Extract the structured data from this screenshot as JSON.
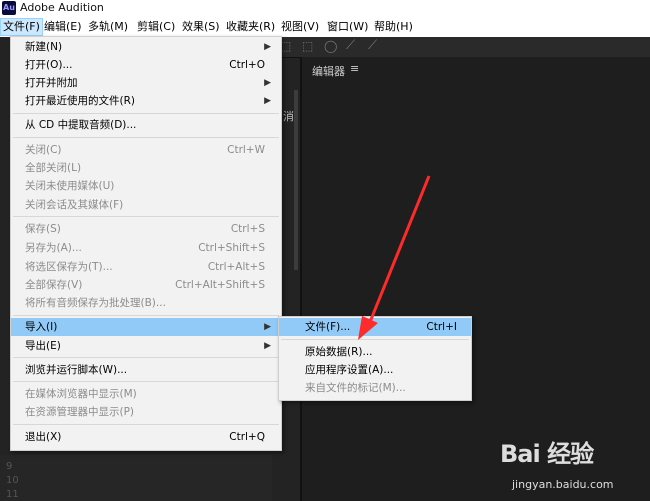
{
  "window": {
    "title": "Adobe Audition",
    "icon": "Au"
  },
  "menubar": [
    {
      "label": "文件(F)",
      "active": true
    },
    {
      "label": "编辑(E)"
    },
    {
      "label": "多轨(M)"
    },
    {
      "label": "剪辑(C)"
    },
    {
      "label": "效果(S)"
    },
    {
      "label": "收藏夹(R)"
    },
    {
      "label": "视图(V)"
    },
    {
      "label": "窗口(W)"
    },
    {
      "label": "帮助(H)"
    }
  ],
  "editor": {
    "tab_label": "编辑器",
    "tab_menu": "≡"
  },
  "file_menu": {
    "items": [
      {
        "label": "新建(N)",
        "shortcut": "",
        "submenu": true,
        "disabled": false
      },
      {
        "label": "打开(O)...",
        "shortcut": "Ctrl+O",
        "submenu": false,
        "disabled": false
      },
      {
        "label": "打开并附加",
        "shortcut": "",
        "submenu": true,
        "disabled": false
      },
      {
        "label": "打开最近使用的文件(R)",
        "shortcut": "",
        "submenu": true,
        "disabled": false
      },
      {
        "label": "从 CD 中提取音频(D)...",
        "shortcut": "",
        "submenu": false,
        "disabled": false
      },
      {
        "label": "关闭(C)",
        "shortcut": "Ctrl+W",
        "submenu": false,
        "disabled": true
      },
      {
        "label": "全部关闭(L)",
        "shortcut": "",
        "submenu": false,
        "disabled": true
      },
      {
        "label": "关闭未使用媒体(U)",
        "shortcut": "",
        "submenu": false,
        "disabled": true
      },
      {
        "label": "关闭会话及其媒体(F)",
        "shortcut": "",
        "submenu": false,
        "disabled": true
      },
      {
        "label": "保存(S)",
        "shortcut": "Ctrl+S",
        "submenu": false,
        "disabled": true
      },
      {
        "label": "另存为(A)...",
        "shortcut": "Ctrl+Shift+S",
        "submenu": false,
        "disabled": true
      },
      {
        "label": "将选区保存为(T)...",
        "shortcut": "Ctrl+Alt+S",
        "submenu": false,
        "disabled": true
      },
      {
        "label": "全部保存(V)",
        "shortcut": "Ctrl+Alt+Shift+S",
        "submenu": false,
        "disabled": true
      },
      {
        "label": "将所有音频保存为批处理(B)...",
        "shortcut": "",
        "submenu": false,
        "disabled": true
      },
      {
        "label": "导入(I)",
        "shortcut": "",
        "submenu": true,
        "disabled": false,
        "highlighted": true
      },
      {
        "label": "导出(E)",
        "shortcut": "",
        "submenu": true,
        "disabled": false
      },
      {
        "label": "浏览并运行脚本(W)...",
        "shortcut": "",
        "submenu": false,
        "disabled": false
      },
      {
        "label": "在媒体浏览器中显示(M)",
        "shortcut": "",
        "submenu": false,
        "disabled": true
      },
      {
        "label": "在资源管理器中显示(P)",
        "shortcut": "",
        "submenu": false,
        "disabled": true
      },
      {
        "label": "退出(X)",
        "shortcut": "Ctrl+Q",
        "submenu": false,
        "disabled": false
      }
    ]
  },
  "import_submenu": {
    "items": [
      {
        "label": "文件(F)...",
        "shortcut": "Ctrl+I",
        "disabled": false,
        "highlighted": true
      },
      {
        "label": "原始数据(R)...",
        "shortcut": "",
        "disabled": false
      },
      {
        "label": "应用程序设置(A)...",
        "shortcut": "",
        "disabled": false
      },
      {
        "label": "来自文件的标记(M)...",
        "shortcut": "",
        "disabled": true
      }
    ]
  },
  "panel_fragments": {
    "side_char": "消"
  },
  "row_numbers": [
    "9",
    "10",
    "11"
  ],
  "watermark": {
    "main": "Bai 经验",
    "sub": "jingyan.baidu.com"
  },
  "colors": {
    "highlight": "#91c9f7",
    "annotation_arrow": "#ff2a2a",
    "menu_bg": "#f2f2f2",
    "disabled_text": "#8c8c8c"
  }
}
